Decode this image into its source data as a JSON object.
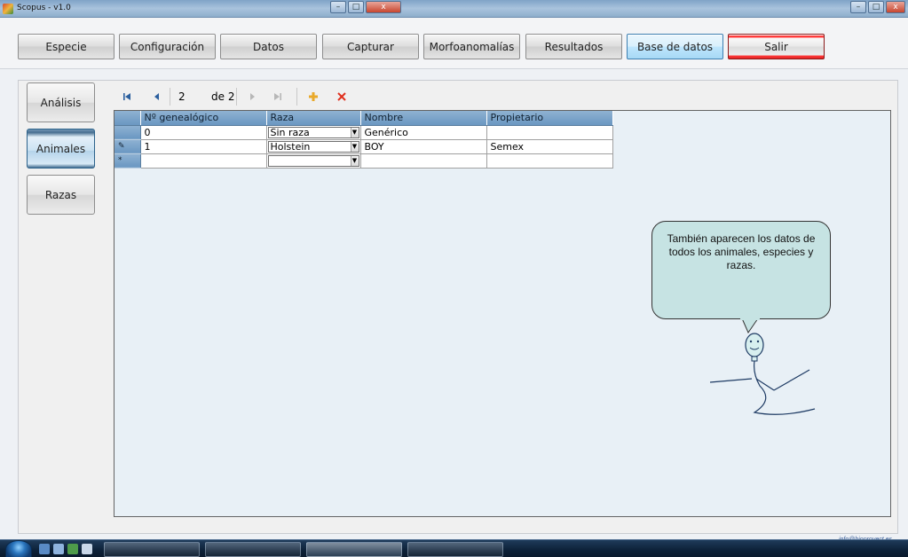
{
  "window": {
    "title": "Scopus - v1.0"
  },
  "nav": {
    "buttons": [
      {
        "label": "Especie"
      },
      {
        "label": "Configuración"
      },
      {
        "label": "Datos"
      },
      {
        "label": "Capturar"
      },
      {
        "label": "Morfoanomalías"
      },
      {
        "label": "Resultados"
      },
      {
        "label": "Base de datos",
        "active": true
      },
      {
        "label": "Salir",
        "style": "danger"
      }
    ]
  },
  "sidebar": {
    "items": [
      {
        "label": "Análisis"
      },
      {
        "label": "Animales",
        "active": true
      },
      {
        "label": "Razas"
      }
    ]
  },
  "navigator": {
    "position": "2",
    "count_label": "de 2",
    "icons": [
      "first-record-icon",
      "previous-record-icon",
      "next-record-icon",
      "last-record-icon",
      "add-record-icon",
      "delete-record-icon"
    ]
  },
  "grid": {
    "columns": [
      "Nº genealógico",
      "Raza",
      "Nombre",
      "Propietario"
    ],
    "rows": [
      {
        "marker": "",
        "genealogico": "0",
        "raza": "Sin raza",
        "nombre": "Genérico",
        "propietario": ""
      },
      {
        "marker": "✎",
        "genealogico": "1",
        "raza": "Holstein",
        "nombre": "BOY",
        "propietario": "Semex"
      },
      {
        "marker": "*",
        "genealogico": "",
        "raza": "",
        "nombre": "",
        "propietario": ""
      }
    ]
  },
  "callout": {
    "text": "También aparecen los datos de todos los animales, especies y razas."
  },
  "footer": {
    "note": "info@bioproyect.es"
  },
  "colors": {
    "active_nav_border": "#3c7fb1",
    "danger_accent": "#ff3b3b",
    "grid_header": "#6a97c2",
    "callout_fill": "#c6e3e3"
  }
}
